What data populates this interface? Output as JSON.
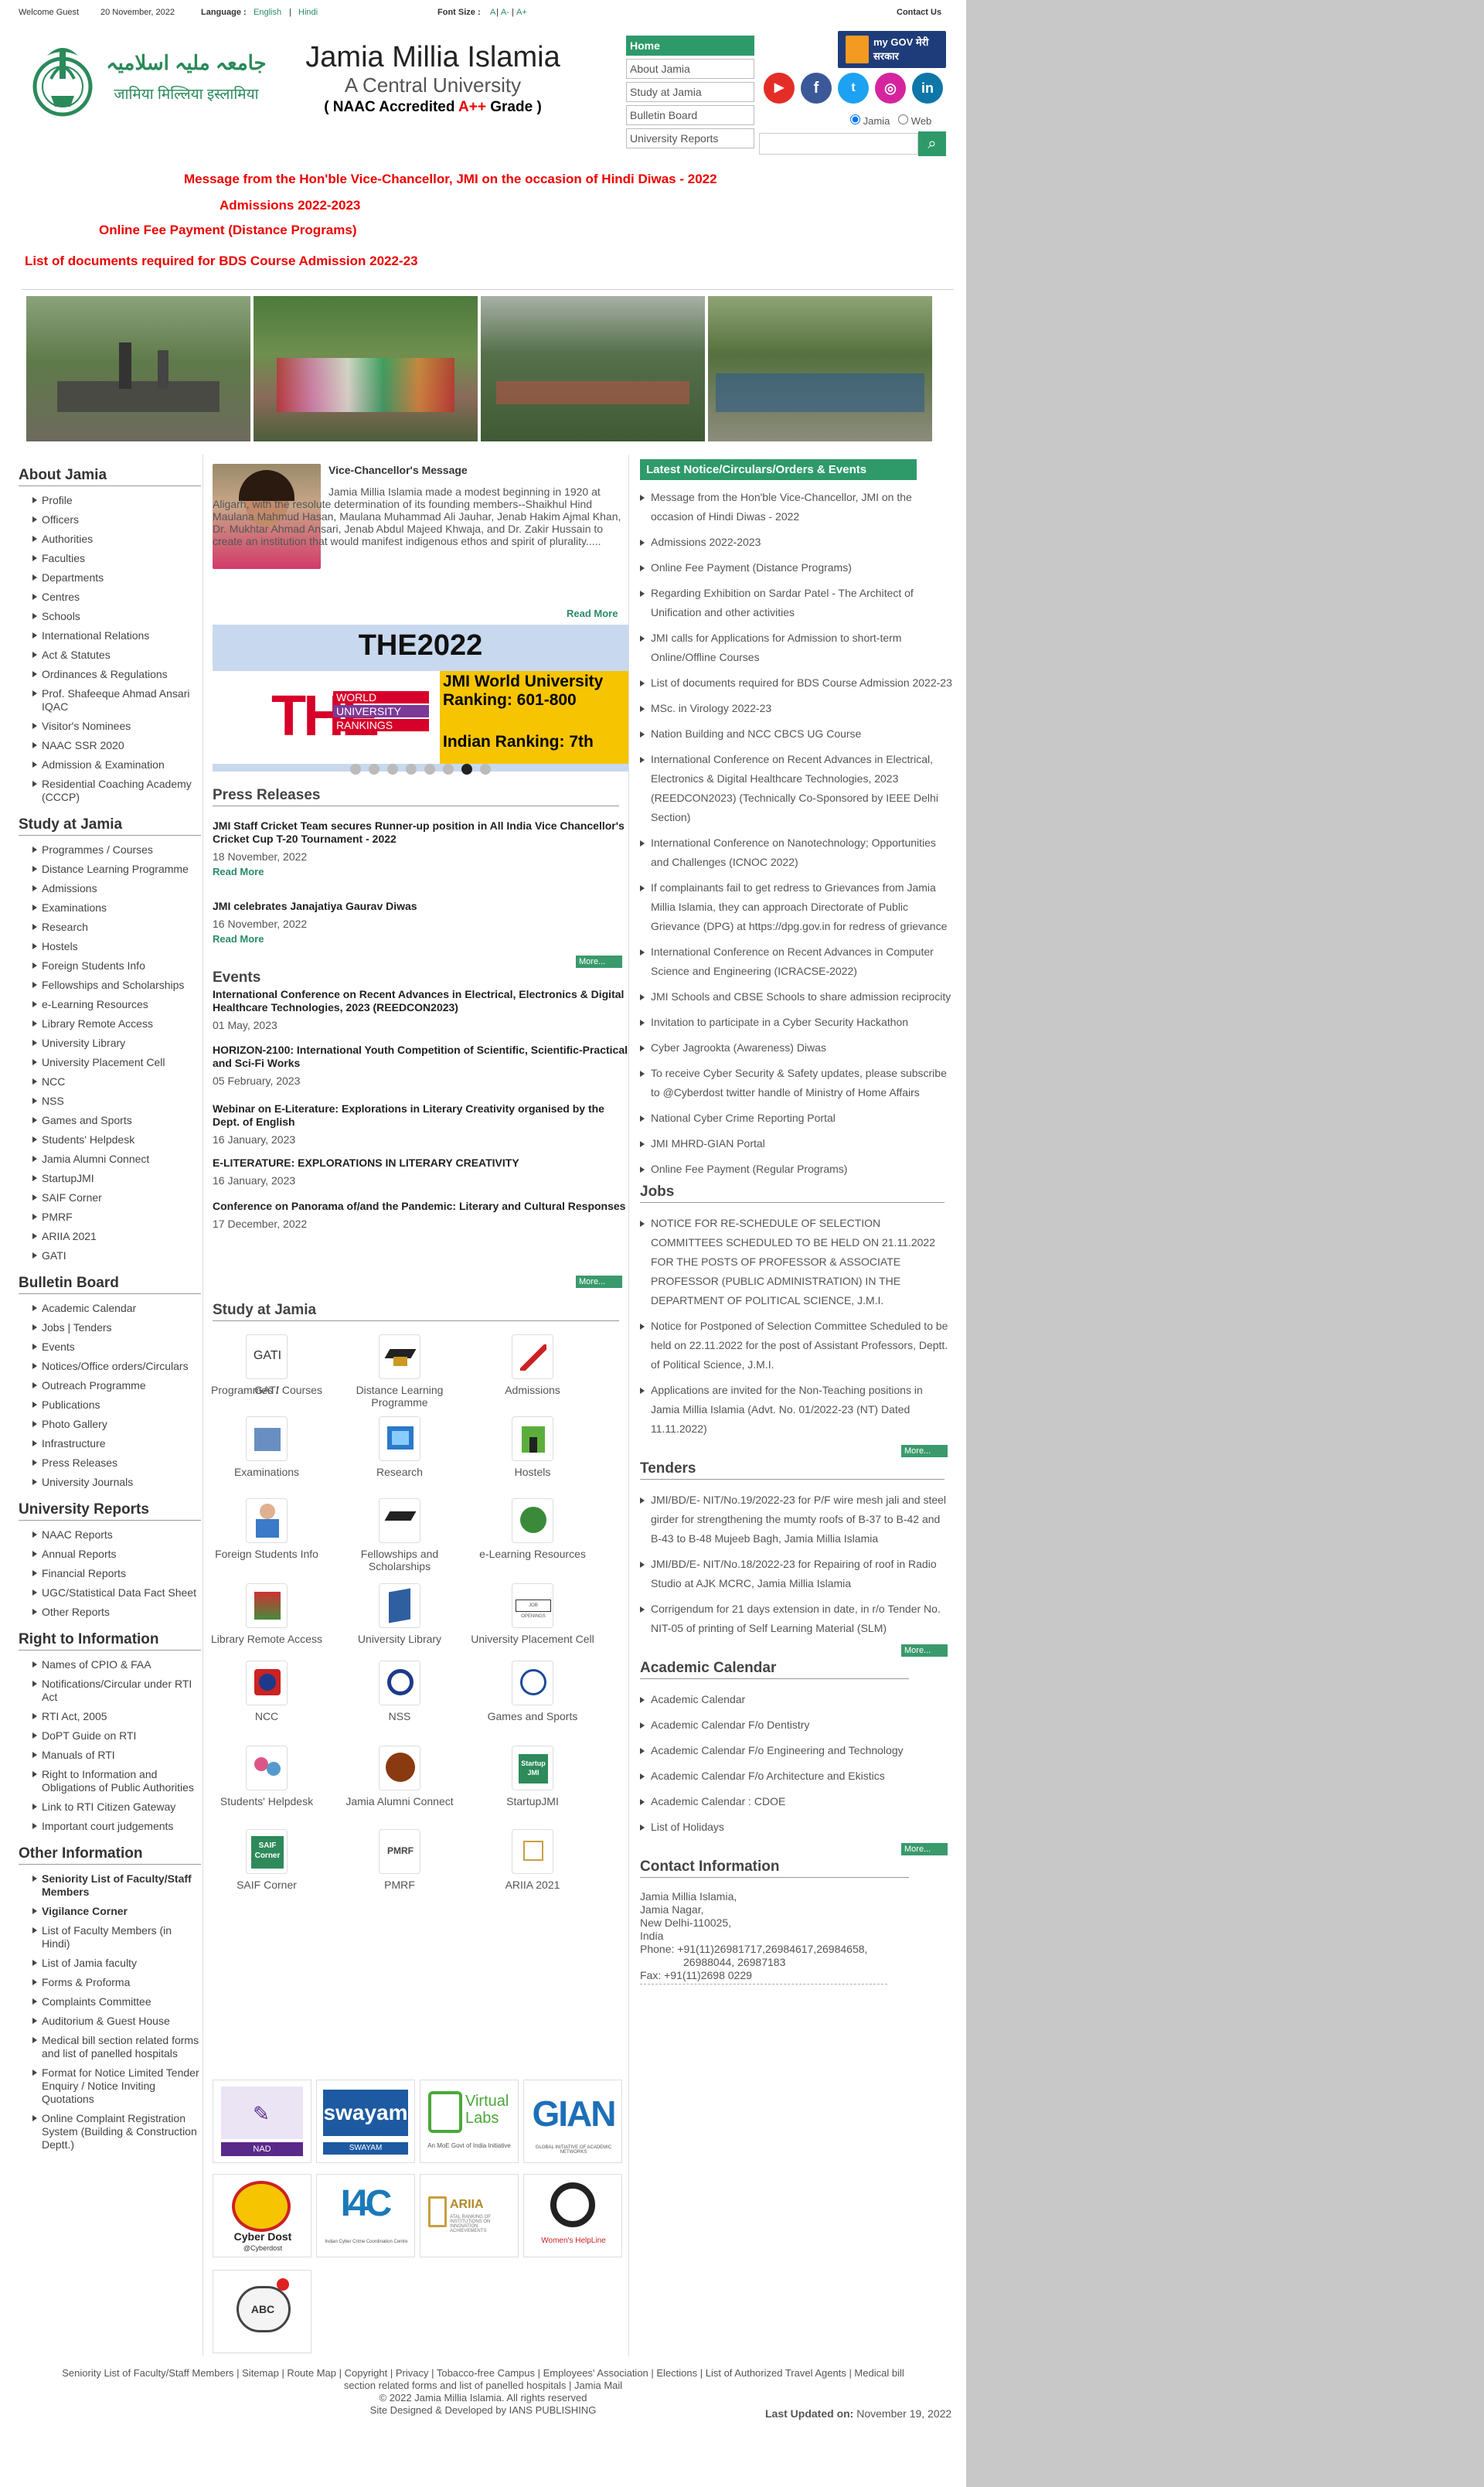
{
  "topbar": {
    "welcome": "Welcome Guest",
    "date": "20 November, 2022",
    "language_label": "Language :",
    "lang_en": "English",
    "lang_sep": " | ",
    "lang_hi": "Hindi",
    "font_label": "Font Size :",
    "font_a": "A",
    "font_aminus": "A-",
    "font_aplus": "A+",
    "contact": "Contact Us"
  },
  "header": {
    "urdu": "جامعہ ملیہ اسلامیہ",
    "hindi": "जामिया मिल्लिया इस्लामिया",
    "title": "Jamia Millia Islamia",
    "subtitle": "A Central University",
    "naac_pre": "( NAAC Accredited ",
    "naac_grade": "A++",
    "naac_post": " Grade )"
  },
  "topnav": [
    "Home",
    "About Jamia",
    "Study at Jamia",
    "Bulletin Board",
    "University Reports"
  ],
  "mygov": "my GOV मेरी सरकार",
  "search": {
    "radio_jamia": "Jamia",
    "radio_web": "Web",
    "placeholder": ""
  },
  "alerts": [
    "Message from the Hon'ble Vice-Chancellor, JMI on the occasion of Hindi Diwas - 2022",
    "Admissions 2022-2023",
    "Online Fee Payment (Distance Programs)",
    "List of documents required for BDS Course Admission 2022-23"
  ],
  "left": {
    "about_title": "About Jamia",
    "about": [
      "Profile",
      "Officers",
      "Authorities",
      "Faculties",
      "Departments",
      "Centres",
      "Schools",
      "International Relations",
      "Act & Statutes",
      "Ordinances & Regulations",
      "Prof. Shafeeque Ahmad Ansari IQAC",
      "Visitor's Nominees",
      "NAAC SSR 2020",
      "Admission & Examination",
      "Residential Coaching Academy (CCCP)"
    ],
    "study_title": "Study at Jamia",
    "study": [
      "Programmes / Courses",
      "Distance Learning Programme",
      "Admissions",
      "Examinations",
      "Research",
      "Hostels",
      "Foreign Students Info",
      "Fellowships and Scholarships",
      "e-Learning Resources",
      "Library Remote Access",
      "University Library",
      "University Placement Cell",
      "NCC",
      "NSS",
      "Games and Sports",
      "Students' Helpdesk",
      "Jamia Alumni Connect",
      "StartupJMI",
      "SAIF Corner",
      "PMRF",
      "ARIIA 2021",
      "GATI"
    ],
    "bulletin_title": "Bulletin Board",
    "bulletin": [
      "Academic Calendar",
      "Jobs | Tenders",
      "Events",
      "Notices/Office orders/Circulars",
      "Outreach Programme",
      "Publications",
      "Photo Gallery",
      "Infrastructure",
      "Press Releases",
      "University Journals"
    ],
    "reports_title": "University Reports",
    "reports": [
      "NAAC Reports",
      "Annual Reports",
      "Financial Reports",
      "UGC/Statistical Data Fact Sheet",
      "Other Reports"
    ],
    "rti_title": "Right to Information",
    "rti": [
      "Names of CPIO & FAA",
      "Notifications/Circular under RTI Act",
      "RTI Act, 2005",
      "DoPT Guide on RTI",
      "Manuals of RTI",
      "Right to Information and Obligations of Public Authorities",
      "Link to RTI Citizen Gateway",
      "Important court judgements"
    ],
    "other_title": "Other Information",
    "other": [
      "Seniority List of Faculty/Staff Members",
      "Vigilance Corner",
      "List of Faculty Members (in Hindi)",
      "List of Jamia faculty",
      "Forms & Proforma",
      "Complaints Committee",
      "Auditorium & Guest House",
      "Medical bill section related forms and list of panelled hospitals",
      "Format for Notice Limited Tender Enquiry / Notice Inviting Quotations",
      "Online Complaint Registration System (Building & Construction Deptt.)"
    ]
  },
  "vc": {
    "title": "Vice-Chancellor's Message",
    "text": "Jamia Millia Islamia made a modest beginning in 1920 at Aligarh, with the resolute determination of its founding members--Shaikhul Hind Maulana Mahmud Hasan, Maulana Muhammad Ali Jauhar, Jenab Hakim Ajmal Khan, Dr. Mukhtar Ahmad Ansari, Jenab Abdul Majeed Khwaja, and Dr. Zakir Hussain to create an institution that would manifest indigenous ethos and spirit of plurality.....",
    "read_more": "Read More"
  },
  "banner": {
    "heading": "THE2022",
    "logo_big": "THE",
    "logo_lines": [
      "WORLD",
      "UNIVERSITY",
      "RANKINGS"
    ],
    "rank1": "JMI World University Ranking: 601-800",
    "rank2": "Indian Ranking: 7th",
    "dots": 8,
    "active_dot": 6
  },
  "press": {
    "title": "Press Releases",
    "items": [
      {
        "headline": "JMI Staff Cricket Team secures Runner-up position in All India Vice Chancellor's Cricket Cup T-20 Tournament - 2022",
        "date": "18 November, 2022",
        "read": "Read More"
      },
      {
        "headline": "JMI celebrates Janajatiya Gaurav Diwas",
        "date": "16 November, 2022",
        "read": "Read More"
      }
    ],
    "more": "More..."
  },
  "events": {
    "title": "Events",
    "items": [
      {
        "headline": "International Conference on Recent Advances in Electrical, Electronics & Digital Healthcare Technologies, 2023 (REEDCON2023)",
        "date": "01 May, 2023"
      },
      {
        "headline": "HORIZON-2100: International Youth Competition of Scientific, Scientific-Practical and Sci-Fi Works",
        "date": "05 February, 2023"
      },
      {
        "headline": "Webinar on E-Literature: Explorations in Literary Creativity organised by the Dept. of English",
        "date": "16 January, 2023"
      },
      {
        "headline": "E-LITERATURE: EXPLORATIONS IN LITERARY CREATIVITY",
        "date": "16 January, 2023"
      },
      {
        "headline": "Conference on Panorama of/and the Pandemic: Literary and Cultural Responses",
        "date": "17 December, 2022"
      }
    ],
    "more": "More..."
  },
  "study_grid": {
    "title": "Study at Jamia",
    "items": [
      "Programmes / Courses",
      "Distance Learning Programme",
      "Admissions",
      "Examinations",
      "Research",
      "Hostels",
      "Foreign Students Info",
      "Fellowships and Scholarships",
      "e-Learning Resources",
      "Library Remote Access",
      "University Library",
      "University Placement Cell",
      "NCC",
      "NSS",
      "Games and Sports",
      "Students' Helpdesk",
      "Jamia Alumni Connect",
      "StartupJMI",
      "SAIF Corner",
      "PMRF",
      "ARIIA 2021",
      "GATI"
    ],
    "icon_text": {
      "startup": "Startup JMI",
      "saif": "SAIF Corner",
      "pmrf": "PMRF",
      "gati": "GATI",
      "placement": "JOB OPENINGS"
    }
  },
  "partners": [
    "NAD",
    "swayam",
    "Virtual Labs",
    "GIAN",
    "Cyber Dost",
    "I4C",
    "ARIIA",
    "Women's HelpLine",
    "ABC"
  ],
  "partner_sub": {
    "nad": "NAD",
    "swayam": "SWAYAM",
    "vlabs": "An MoE Govt of India Initiative",
    "gian": "GLOBAL INITIATIVE OF ACADEMIC NETWORKS",
    "cyber": "@Cyberdost",
    "i4c": "Indian Cyber Crime Coordination Centre",
    "ariia": "ATAL RANKING OF INSTITUTIONS ON INNOVATION ACHIEVEMENTS"
  },
  "notices": {
    "title": "Latest Notice/Circulars/Orders & Events",
    "items": [
      "Message from the Hon'ble Vice-Chancellor, JMI on the occasion of Hindi Diwas - 2022",
      "Admissions 2022-2023",
      "Online Fee Payment (Distance Programs)",
      "Regarding Exhibition on Sardar Patel - The Architect of Unification and other activities",
      "JMI calls for Applications for Admission to short-term Online/Offline Courses",
      "List of documents required for BDS Course Admission 2022-23",
      "MSc. in Virology 2022-23",
      "Nation Building and NCC CBCS UG Course",
      "International Conference on Recent Advances in Electrical, Electronics & Digital Healthcare Technologies, 2023 (REEDCON2023) (Technically Co-Sponsored by IEEE Delhi Section)",
      "International Conference on Nanotechnology; Opportunities and Challenges (ICNOC 2022)",
      "If complainants fail to get redress to Grievances from Jamia Millia Islamia, they can approach Directorate of Public Grievance (DPG) at https://dpg.gov.in for redress of grievance",
      "International Conference on Recent Advances in Computer Science and Engineering (ICRACSE-2022)",
      "JMI Schools and CBSE Schools to share admission reciprocity",
      "Invitation to participate in a Cyber Security Hackathon",
      "Cyber Jagrookta (Awareness) Diwas",
      "To receive Cyber Security & Safety updates, please subscribe to @Cyberdost twitter handle of Ministry of Home Affairs",
      "National Cyber Crime Reporting Portal",
      "JMI MHRD-GIAN Portal",
      "Online Fee Payment (Regular Programs)"
    ]
  },
  "jobs": {
    "title": "Jobs",
    "items": [
      "NOTICE FOR RE-SCHEDULE OF SELECTION COMMITTEES SCHEDULED TO BE HELD ON 21.11.2022 FOR THE POSTS OF PROFESSOR & ASSOCIATE PROFESSOR (PUBLIC ADMINISTRATION) IN THE DEPARTMENT OF POLITICAL SCIENCE, J.M.I.",
      "Notice for Postponed of Selection Committee Scheduled to be held on 22.11.2022 for the post of Assistant Professors, Deptt. of Political Science, J.M.I.",
      "Applications are invited for the Non-Teaching positions in Jamia Millia Islamia (Advt. No. 01/2022-23 (NT) Dated 11.11.2022)"
    ],
    "more": "More..."
  },
  "tenders": {
    "title": "Tenders",
    "items": [
      "JMI/BD/E- NIT/No.19/2022-23 for P/F wire mesh jali and steel girder for strengthening the mumty roofs of B-37 to B-42 and B-43 to B-48 Mujeeb Bagh, Jamia Millia Islamia",
      "JMI/BD/E- NIT/No.18/2022-23 for Repairing of roof in Radio Studio at AJK MCRC, Jamia Millia Islamia",
      "Corrigendum for 21 days extension in date, in r/o Tender No. NIT-05 of printing of Self Learning Material (SLM)"
    ],
    "more": "More..."
  },
  "academic": {
    "title": "Academic Calendar",
    "items": [
      "Academic Calendar",
      "Academic Calendar F/o Dentistry",
      "Academic Calendar F/o Engineering and Technology",
      "Academic Calendar F/o Architecture and Ekistics",
      "Academic Calendar : CDOE",
      "List of Holidays"
    ],
    "more": "More..."
  },
  "contact": {
    "title": "Contact Information",
    "lines": [
      "Jamia Millia Islamia,",
      "Jamia Nagar,",
      "New Delhi-110025,",
      "India",
      "Phone: +91(11)26981717,26984617,26984658,",
      "26988044, 26987183",
      "Fax: +91(11)2698 0229"
    ]
  },
  "footer": {
    "links": "Seniority List of Faculty/Staff Members | Sitemap | Route Map | Copyright | Privacy | Tobacco-free Campus | Employees' Association | Elections | List of Authorized Travel Agents | Medical bill",
    "links2": "section related forms and list of panelled hospitals | Jamia Mail",
    "copy": "© 2022 Jamia Millia Islamia. All rights reserved",
    "design": "Site Designed & Developed by IANS PUBLISHING",
    "updated_label": "Last Updated on:",
    "updated": "November 19, 2022"
  },
  "colors": {
    "green": "#2e9a6a",
    "red": "#e00000",
    "banner_bg": "#c8d8ee",
    "yellow": "#f6c400",
    "the_red": "#d7002a"
  }
}
